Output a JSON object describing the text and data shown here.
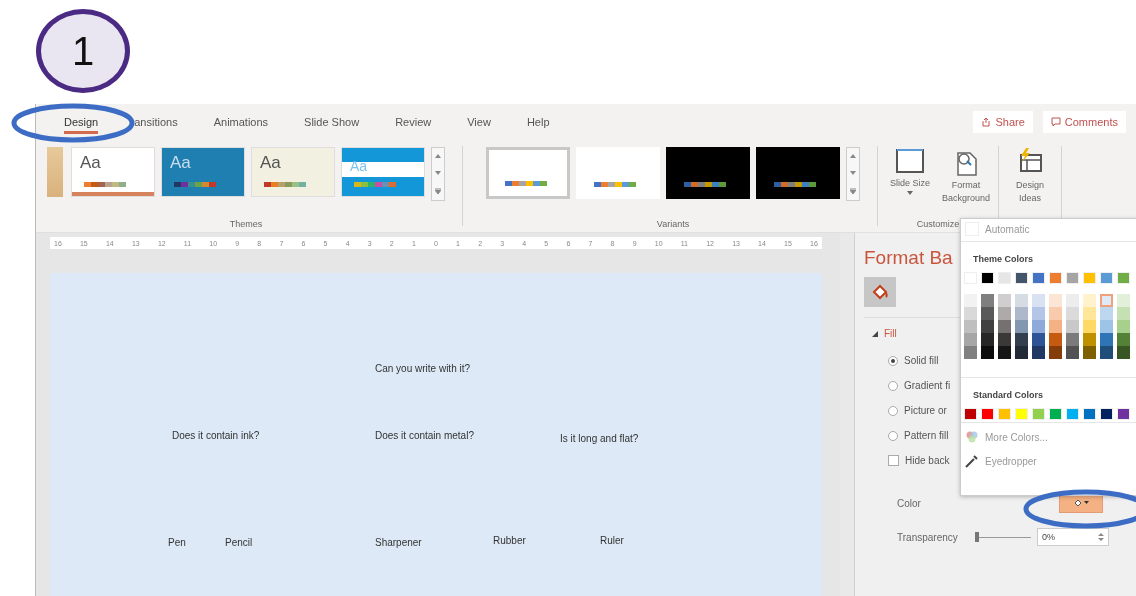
{
  "annotation": {
    "step": "1"
  },
  "tabs": [
    {
      "label": "Design",
      "selected": true
    },
    {
      "label": "ansitions",
      "selected": false
    },
    {
      "label": "Animations",
      "selected": false
    },
    {
      "label": "Slide Show",
      "selected": false
    },
    {
      "label": "Review",
      "selected": false
    },
    {
      "label": "View",
      "selected": false
    },
    {
      "label": "Help",
      "selected": false
    }
  ],
  "share": "Share",
  "comments": "Comments",
  "themes": {
    "label": "Themes",
    "items": [
      {
        "kind": "wood"
      },
      {
        "kind": "office",
        "text": "Aa"
      },
      {
        "kind": "facet",
        "text": "Aa"
      },
      {
        "kind": "cream",
        "text": "Aa"
      },
      {
        "kind": "band",
        "text": "Aa"
      }
    ]
  },
  "variants": {
    "label": "Variants",
    "items": [
      {
        "kind": "light",
        "selected": true
      },
      {
        "kind": "light",
        "selected": false
      },
      {
        "kind": "dark",
        "selected": false
      },
      {
        "kind": "dark",
        "selected": false
      }
    ]
  },
  "customize": {
    "label": "Customize",
    "buttons": [
      {
        "kind": "slide-size",
        "label": "Slide Size",
        "menu": true
      },
      {
        "kind": "format-background",
        "label": "Format Background",
        "menu": false
      }
    ]
  },
  "designer": {
    "buttons": [
      {
        "kind": "design-ideas",
        "label": "Design Ideas",
        "menu": false
      }
    ]
  },
  "ruler": [
    "16",
    "15",
    "14",
    "13",
    "12",
    "11",
    "10",
    "9",
    "8",
    "7",
    "6",
    "5",
    "4",
    "3",
    "2",
    "1",
    "0",
    "1",
    "2",
    "3",
    "4",
    "5",
    "6",
    "7",
    "8",
    "9",
    "10",
    "11",
    "12",
    "13",
    "14",
    "15",
    "16"
  ],
  "slide": {
    "texts": [
      "Can you write with it?",
      "Does it contain ink?",
      "Does it contain metal?",
      "Is it long and flat?",
      "Pen",
      "Pencil",
      "Sharpener",
      "Rubber",
      "Ruler"
    ]
  },
  "format_pane": {
    "title": "Format Ba",
    "section": "Fill",
    "options": [
      {
        "kind": "radio",
        "label": "Solid fill",
        "selected": true
      },
      {
        "kind": "radio",
        "label": "Gradient fi",
        "selected": false
      },
      {
        "kind": "radio",
        "label": "Picture or",
        "selected": false
      },
      {
        "kind": "radio",
        "label": "Pattern fill",
        "selected": false
      },
      {
        "kind": "checkbox",
        "label": "Hide back",
        "checked": false
      }
    ],
    "color_label": "Color",
    "color": "#f4b183",
    "transparency_label": "Transparency",
    "transparency": {
      "level": 0
    },
    "transparency_value": "0%"
  },
  "color_menu": {
    "automatic": "Automatic",
    "theme_title": "Theme Colors",
    "theme": [
      {
        "color": "#ffffff",
        "shades": [
          {
            "color": "#f2f2f2",
            "selected": false
          },
          {
            "color": "#d9d9d9",
            "selected": false
          },
          {
            "color": "#bfbfbf",
            "selected": false
          },
          {
            "color": "#a6a6a6",
            "selected": false
          },
          {
            "color": "#808080",
            "selected": false
          }
        ]
      },
      {
        "color": "#000000",
        "shades": [
          {
            "color": "#7f7f7f",
            "selected": false
          },
          {
            "color": "#595959",
            "selected": false
          },
          {
            "color": "#404040",
            "selected": false
          },
          {
            "color": "#262626",
            "selected": false
          },
          {
            "color": "#0d0d0d",
            "selected": false
          }
        ]
      },
      {
        "color": "#e7e6e6",
        "shades": [
          {
            "color": "#d0cece",
            "selected": false
          },
          {
            "color": "#aeaaaa",
            "selected": false
          },
          {
            "color": "#757171",
            "selected": false
          },
          {
            "color": "#3b3838",
            "selected": false
          },
          {
            "color": "#171616",
            "selected": false
          }
        ]
      },
      {
        "color": "#44546a",
        "shades": [
          {
            "color": "#d6dce4",
            "selected": false
          },
          {
            "color": "#adb9ca",
            "selected": false
          },
          {
            "color": "#8497b0",
            "selected": false
          },
          {
            "color": "#333f4f",
            "selected": false
          },
          {
            "color": "#222a35",
            "selected": false
          }
        ]
      },
      {
        "color": "#4472c4",
        "shades": [
          {
            "color": "#d9e2f3",
            "selected": false
          },
          {
            "color": "#b4c6e7",
            "selected": false
          },
          {
            "color": "#8eaadb",
            "selected": false
          },
          {
            "color": "#2f5496",
            "selected": false
          },
          {
            "color": "#1f3864",
            "selected": false
          }
        ]
      },
      {
        "color": "#ed7d31",
        "shades": [
          {
            "color": "#fbe5d5",
            "selected": false
          },
          {
            "color": "#f7cbac",
            "selected": false
          },
          {
            "color": "#f4b183",
            "selected": false
          },
          {
            "color": "#c55a11",
            "selected": false
          },
          {
            "color": "#843c0b",
            "selected": false
          }
        ]
      },
      {
        "color": "#a5a5a5",
        "shades": [
          {
            "color": "#ededed",
            "selected": false
          },
          {
            "color": "#dbdbdb",
            "selected": false
          },
          {
            "color": "#c9c9c9",
            "selected": false
          },
          {
            "color": "#7b7b7b",
            "selected": false
          },
          {
            "color": "#525252",
            "selected": false
          }
        ]
      },
      {
        "color": "#ffc000",
        "shades": [
          {
            "color": "#fff2cc",
            "selected": false
          },
          {
            "color": "#ffe699",
            "selected": false
          },
          {
            "color": "#ffd966",
            "selected": false
          },
          {
            "color": "#bf9000",
            "selected": false
          },
          {
            "color": "#7f6000",
            "selected": false
          }
        ]
      },
      {
        "color": "#5b9bd5",
        "shades": [
          {
            "color": "#deebf6",
            "selected": true
          },
          {
            "color": "#bdd7ee",
            "selected": false
          },
          {
            "color": "#9dc3e6",
            "selected": false
          },
          {
            "color": "#2e75b5",
            "selected": false
          },
          {
            "color": "#1f4e79",
            "selected": false
          }
        ]
      },
      {
        "color": "#70ad47",
        "shades": [
          {
            "color": "#e2efd9",
            "selected": false
          },
          {
            "color": "#c5e0b3",
            "selected": false
          },
          {
            "color": "#a8d08d",
            "selected": false
          },
          {
            "color": "#538135",
            "selected": false
          },
          {
            "color": "#375623",
            "selected": false
          }
        ]
      }
    ],
    "standard_title": "Standard Colors",
    "standard": [
      {
        "color": "#c00000"
      },
      {
        "color": "#ff0000"
      },
      {
        "color": "#ffc000"
      },
      {
        "color": "#ffff00"
      },
      {
        "color": "#92d050"
      },
      {
        "color": "#00b050"
      },
      {
        "color": "#00b0f0"
      },
      {
        "color": "#0070c0"
      },
      {
        "color": "#002060"
      },
      {
        "color": "#7030a0"
      }
    ],
    "more": "More Colors...",
    "eyedropper": "Eyedropper"
  }
}
